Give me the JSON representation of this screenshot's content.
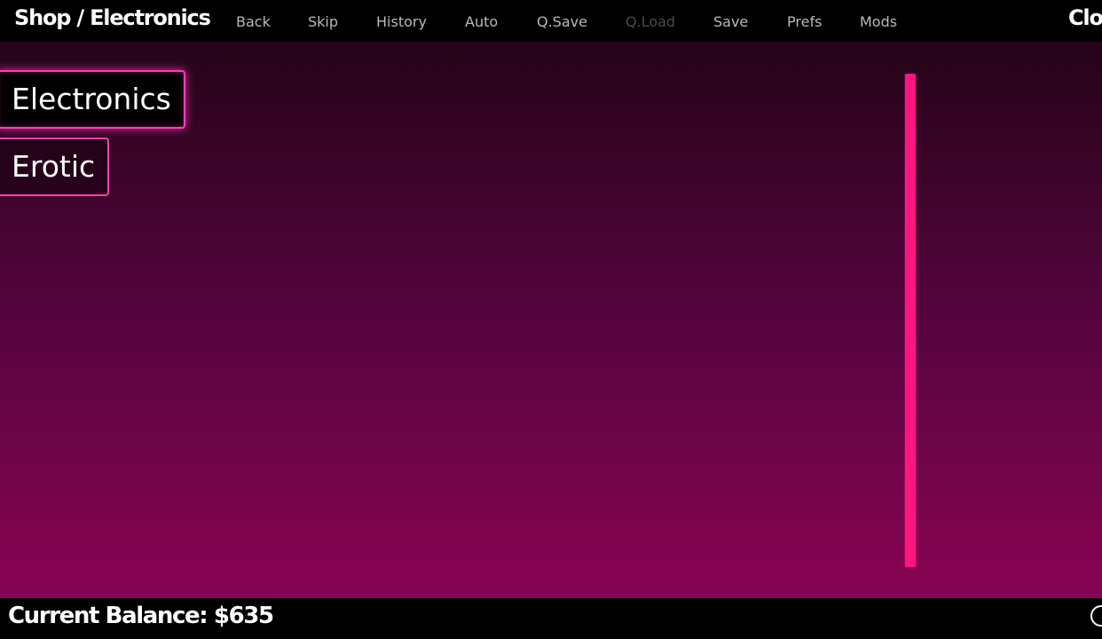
{
  "header": {
    "title": "Shop / Electronics",
    "close_label": "Clos"
  },
  "quick_menu": [
    {
      "label": "Back",
      "enabled": true
    },
    {
      "label": "Skip",
      "enabled": true
    },
    {
      "label": "History",
      "enabled": true
    },
    {
      "label": "Auto",
      "enabled": true
    },
    {
      "label": "Q.Save",
      "enabled": true
    },
    {
      "label": "Q.Load",
      "enabled": false
    },
    {
      "label": "Save",
      "enabled": true
    },
    {
      "label": "Prefs",
      "enabled": true
    },
    {
      "label": "Mods",
      "enabled": true
    }
  ],
  "categories": [
    {
      "label": "Electronics",
      "selected": true
    },
    {
      "label": "Erotic",
      "selected": false
    }
  ],
  "scrollbar": {
    "thumb_fraction": 1.0,
    "position_fraction": 0.0
  },
  "footer": {
    "balance_text": "Current Balance: $635"
  },
  "colors": {
    "accent": "#ff3fb4",
    "scrollbar_thumb": "#ff157f",
    "qm_text": "#b8b8b8",
    "qm_disabled": "#4a4a4a",
    "bg_top": "#1e0513",
    "bg_bottom": "#8b0459"
  },
  "icons": {
    "corner": "circle-icon"
  }
}
